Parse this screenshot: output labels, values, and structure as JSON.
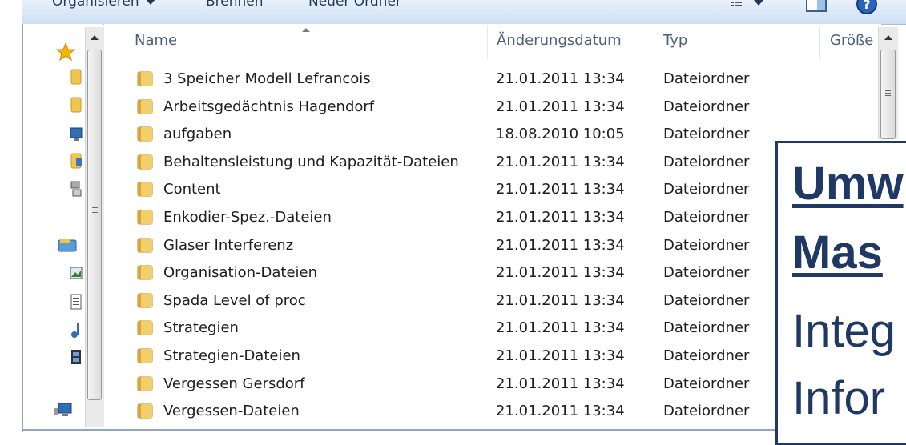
{
  "toolbar": {
    "organize": "Organisieren",
    "burn": "Brennen",
    "new_folder": "Neuer Ordner"
  },
  "columns": {
    "name": "Name",
    "date": "Änderungsdatum",
    "type": "Typ",
    "size": "Größe"
  },
  "rows": [
    {
      "name": "3 Speicher Modell Lefrancois",
      "date": "21.01.2011 13:34",
      "type": "Dateiordner"
    },
    {
      "name": "Arbeitsgedächtnis Hagendorf",
      "date": "21.01.2011 13:34",
      "type": "Dateiordner"
    },
    {
      "name": "aufgaben",
      "date": "18.08.2010 10:05",
      "type": "Dateiordner"
    },
    {
      "name": "Behaltensleistung und Kapazität-Dateien",
      "date": "21.01.2011 13:34",
      "type": "Dateiordner"
    },
    {
      "name": "Content",
      "date": "21.01.2011 13:34",
      "type": "Dateiordner"
    },
    {
      "name": "Enkodier-Spez.-Dateien",
      "date": "21.01.2011 13:34",
      "type": "Dateiordner"
    },
    {
      "name": "Glaser Interferenz",
      "date": "21.01.2011 13:34",
      "type": "Dateiordner"
    },
    {
      "name": "Organisation-Dateien",
      "date": "21.01.2011 13:34",
      "type": "Dateiordner"
    },
    {
      "name": "Spada Level of proc",
      "date": "21.01.2011 13:34",
      "type": "Dateiordner"
    },
    {
      "name": "Strategien",
      "date": "21.01.2011 13:34",
      "type": "Dateiordner"
    },
    {
      "name": "Strategien-Dateien",
      "date": "21.01.2011 13:34",
      "type": "Dateiordner"
    },
    {
      "name": "Vergessen Gersdorf",
      "date": "21.01.2011 13:34",
      "type": "Dateiordner"
    },
    {
      "name": "Vergessen-Dateien",
      "date": "21.01.2011 13:34",
      "type": "Dateiordner"
    }
  ],
  "nav_icons": [
    "star-icon",
    "folder-icon",
    "folder-icon",
    "desktop-icon",
    "folder-icon",
    "network-icon",
    "library-icon",
    "pictures-icon",
    "documents-icon",
    "music-icon",
    "videos-icon",
    "computer-icon"
  ],
  "overlay": {
    "line1": "Umw",
    "line2": "Mas",
    "line3": "Integ",
    "line4": "Infor"
  },
  "colors": {
    "overlay_text": "#1f3864",
    "folder": "#e8b84a",
    "toolbar_bg": "#dbe7f6"
  }
}
